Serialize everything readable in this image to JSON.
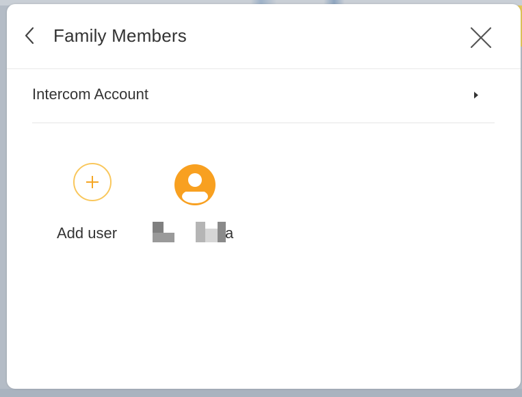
{
  "dialog": {
    "title": "Family Members",
    "back_icon": "chevron-left-icon",
    "close_icon": "close-icon"
  },
  "menu": {
    "intercom_account_label": "Intercom Account",
    "arrow_icon": "caret-right-icon"
  },
  "members": {
    "add_user_label": "Add user",
    "add_icon": "plus-circle-icon",
    "users": [
      {
        "avatar_icon": "user-avatar-icon",
        "name_visible_suffix": "a",
        "name_redacted": true
      }
    ]
  },
  "colors": {
    "accent_orange": "#f8a020",
    "add_ring": "#f9c75c",
    "text": "#333333",
    "divider": "#e5e5e5"
  }
}
